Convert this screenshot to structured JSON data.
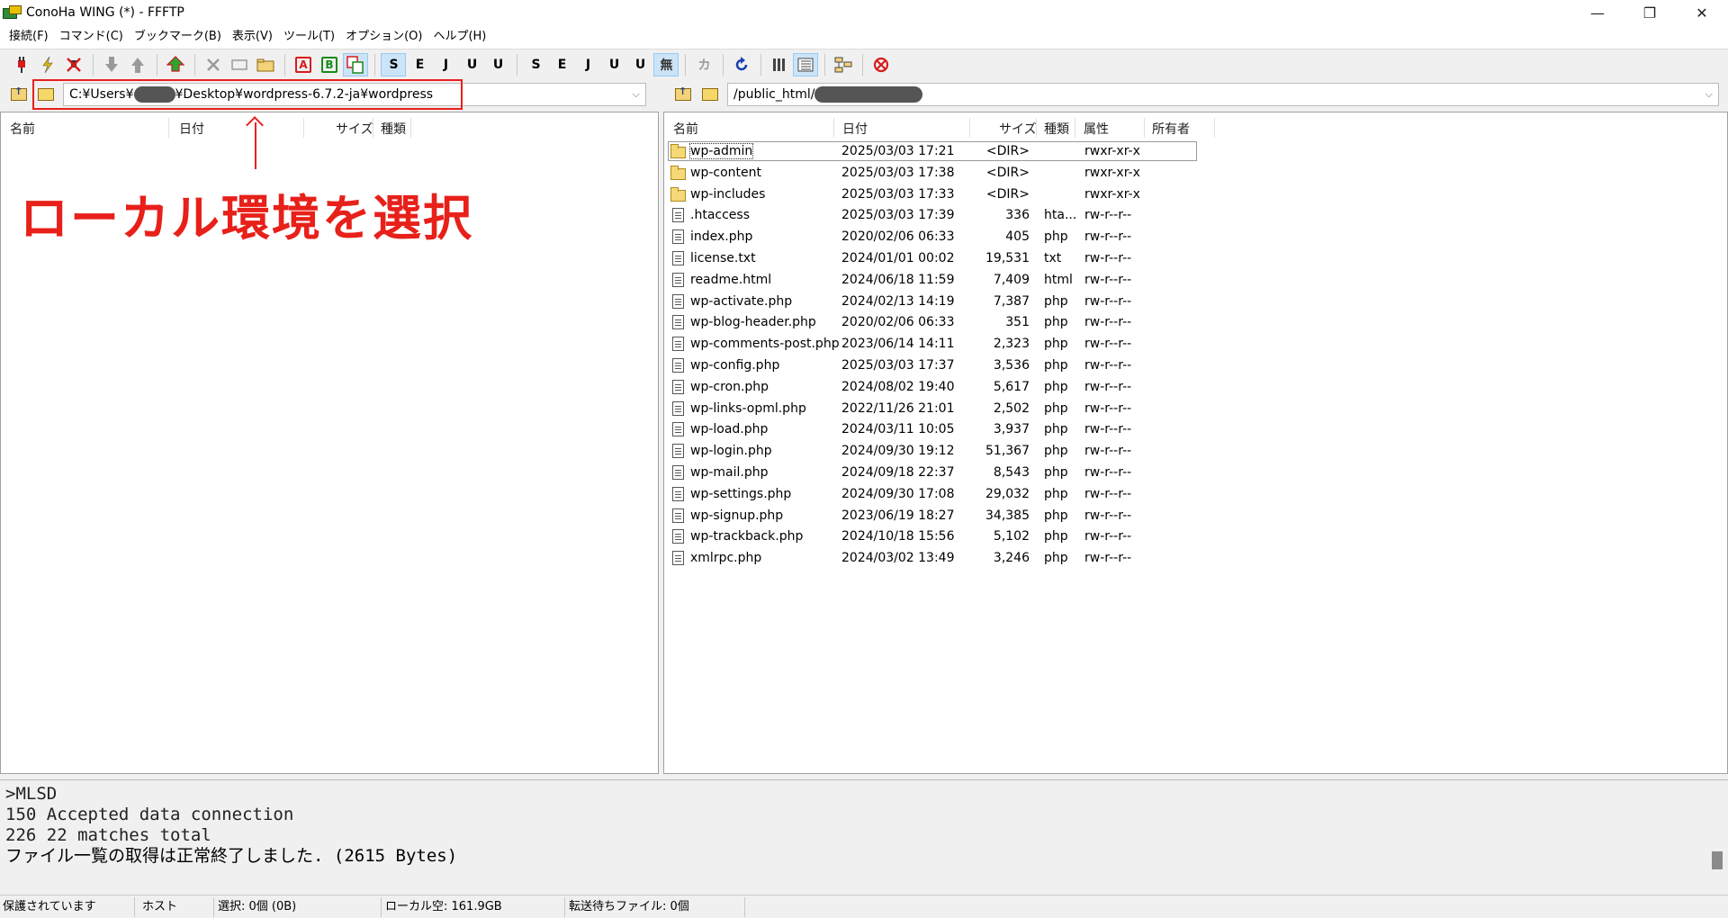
{
  "window": {
    "title": "ConoHa WING (*) - FFFTP",
    "minimize": "—",
    "maximize": "❐",
    "close": "✕"
  },
  "menu": [
    "接続(F)",
    "コマンド(C)",
    "ブックマーク(B)",
    "表示(V)",
    "ツール(T)",
    "オプション(O)",
    "ヘルプ(H)"
  ],
  "toolbar": {
    "ascii_mode": "A",
    "binary_mode": "B",
    "sjis": "S",
    "euc": "E",
    "jis": "J",
    "utf8": "U",
    "utf8bom": "U",
    "kana": "カ",
    "no_convert": "無"
  },
  "local": {
    "path_prefix": "C:¥Users¥",
    "path_suffix": "¥Desktop¥wordpress-6.7.2-ja¥wordpress",
    "columns": {
      "name": "名前",
      "date": "日付",
      "size": "サイズ",
      "type": "種類"
    }
  },
  "remote": {
    "path_prefix": "/public_html/",
    "columns": {
      "name": "名前",
      "date": "日付",
      "size": "サイズ",
      "type": "種類",
      "attr": "属性",
      "owner": "所有者"
    },
    "files": [
      {
        "name": "wp-admin",
        "date": "2025/03/03 17:21",
        "size": "<DIR>",
        "type": "",
        "attr": "rwxr-xr-x",
        "icon": "folder"
      },
      {
        "name": "wp-content",
        "date": "2025/03/03 17:38",
        "size": "<DIR>",
        "type": "",
        "attr": "rwxr-xr-x",
        "icon": "folder"
      },
      {
        "name": "wp-includes",
        "date": "2025/03/03 17:33",
        "size": "<DIR>",
        "type": "",
        "attr": "rwxr-xr-x",
        "icon": "folder"
      },
      {
        "name": ".htaccess",
        "date": "2025/03/03 17:39",
        "size": "336",
        "type": "hta...",
        "attr": "rw-r--r--",
        "icon": "file"
      },
      {
        "name": "index.php",
        "date": "2020/02/06 06:33",
        "size": "405",
        "type": "php",
        "attr": "rw-r--r--",
        "icon": "file"
      },
      {
        "name": "license.txt",
        "date": "2024/01/01 00:02",
        "size": "19,531",
        "type": "txt",
        "attr": "rw-r--r--",
        "icon": "file"
      },
      {
        "name": "readme.html",
        "date": "2024/06/18 11:59",
        "size": "7,409",
        "type": "html",
        "attr": "rw-r--r--",
        "icon": "file"
      },
      {
        "name": "wp-activate.php",
        "date": "2024/02/13 14:19",
        "size": "7,387",
        "type": "php",
        "attr": "rw-r--r--",
        "icon": "file"
      },
      {
        "name": "wp-blog-header.php",
        "date": "2020/02/06 06:33",
        "size": "351",
        "type": "php",
        "attr": "rw-r--r--",
        "icon": "file"
      },
      {
        "name": "wp-comments-post.php",
        "date": "2023/06/14 14:11",
        "size": "2,323",
        "type": "php",
        "attr": "rw-r--r--",
        "icon": "file"
      },
      {
        "name": "wp-config.php",
        "date": "2025/03/03 17:37",
        "size": "3,536",
        "type": "php",
        "attr": "rw-r--r--",
        "icon": "file"
      },
      {
        "name": "wp-cron.php",
        "date": "2024/08/02 19:40",
        "size": "5,617",
        "type": "php",
        "attr": "rw-r--r--",
        "icon": "file"
      },
      {
        "name": "wp-links-opml.php",
        "date": "2022/11/26 21:01",
        "size": "2,502",
        "type": "php",
        "attr": "rw-r--r--",
        "icon": "file"
      },
      {
        "name": "wp-load.php",
        "date": "2024/03/11 10:05",
        "size": "3,937",
        "type": "php",
        "attr": "rw-r--r--",
        "icon": "file"
      },
      {
        "name": "wp-login.php",
        "date": "2024/09/30 19:12",
        "size": "51,367",
        "type": "php",
        "attr": "rw-r--r--",
        "icon": "file"
      },
      {
        "name": "wp-mail.php",
        "date": "2024/09/18 22:37",
        "size": "8,543",
        "type": "php",
        "attr": "rw-r--r--",
        "icon": "file"
      },
      {
        "name": "wp-settings.php",
        "date": "2024/09/30 17:08",
        "size": "29,032",
        "type": "php",
        "attr": "rw-r--r--",
        "icon": "file"
      },
      {
        "name": "wp-signup.php",
        "date": "2023/06/19 18:27",
        "size": "34,385",
        "type": "php",
        "attr": "rw-r--r--",
        "icon": "file"
      },
      {
        "name": "wp-trackback.php",
        "date": "2024/10/18 15:56",
        "size": "5,102",
        "type": "php",
        "attr": "rw-r--r--",
        "icon": "file"
      },
      {
        "name": "xmlrpc.php",
        "date": "2024/03/02 13:49",
        "size": "3,246",
        "type": "php",
        "attr": "rw-r--r--",
        "icon": "file"
      }
    ]
  },
  "annotation": {
    "text": "ローカル環境を選択",
    "arrow": "↑",
    "color": "#e8201a"
  },
  "log": [
    ">MLSD",
    "150 Accepted data connection",
    "226 22 matches total",
    "ファイル一覧の取得は正常終了しました. (2615 Bytes)"
  ],
  "status": {
    "security": "保護されています",
    "host": "ホスト",
    "selection": "選択: 0個 (0B)",
    "local_free": "ローカル空: 161.9GB",
    "queue": "転送待ちファイル: 0個"
  }
}
